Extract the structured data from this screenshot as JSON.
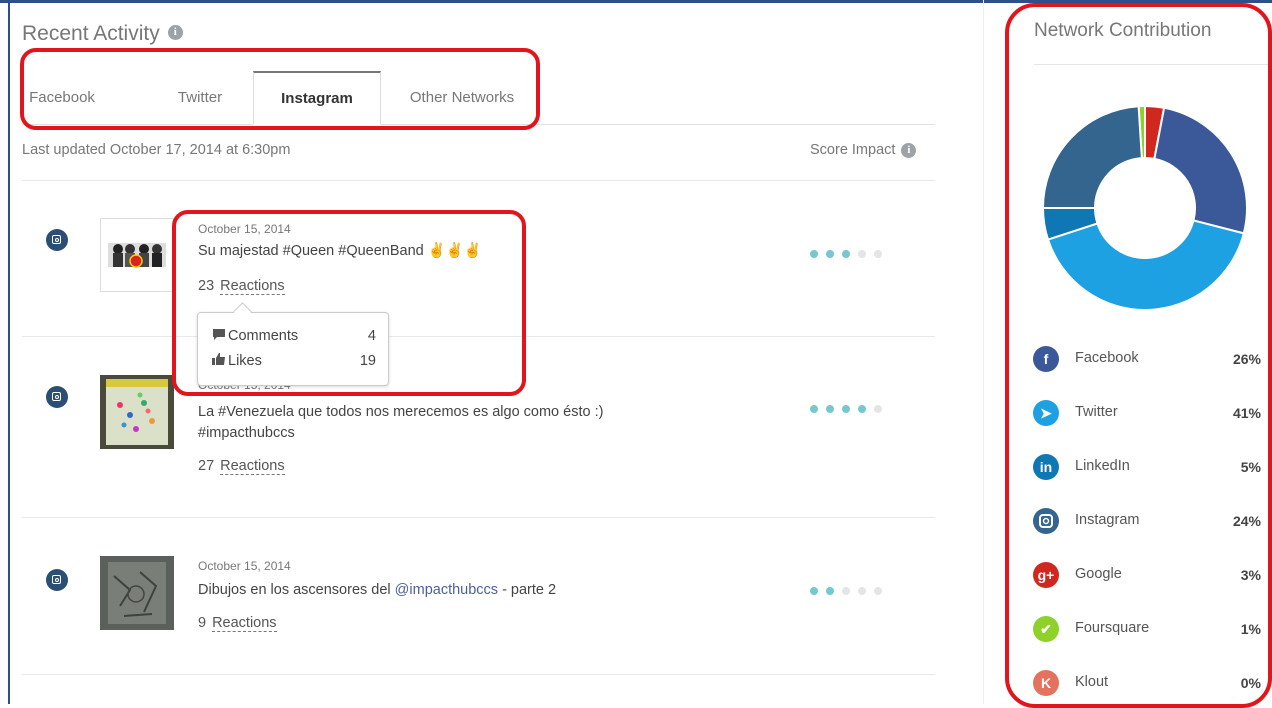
{
  "header": {
    "title": "Recent Activity"
  },
  "tabs": [
    {
      "label": "Facebook",
      "active": false
    },
    {
      "label": "Twitter",
      "active": false
    },
    {
      "label": "Instagram",
      "active": true
    },
    {
      "label": "Other Networks",
      "active": false
    }
  ],
  "last_updated": "Last updated October 17, 2014 at 6:30pm",
  "score_impact_label": "Score Impact",
  "posts": [
    {
      "network_icon": "instagram-icon",
      "date": "October 15, 2014",
      "text": "Su majestad #Queen #QueenBand ✌✌✌",
      "text_line2": "",
      "mention": "",
      "suffix": "",
      "reactions_count": "23",
      "reactions_label": "Reactions",
      "score": 3,
      "score_max": 5
    },
    {
      "network_icon": "instagram-icon",
      "date": "October 15, 2014",
      "text": "La #Venezuela que todos nos merecemos es algo como ésto :)",
      "text_line2": "#impacthubccs",
      "mention": "",
      "suffix": "",
      "reactions_count": "27",
      "reactions_label": "Reactions",
      "score": 4,
      "score_max": 5
    },
    {
      "network_icon": "instagram-icon",
      "date": "October 15, 2014",
      "text": "Dibujos en los ascensores del ",
      "text_line2": "",
      "mention": "@impacthubccs",
      "suffix": " - parte 2",
      "reactions_count": "9",
      "reactions_label": "Reactions",
      "score": 2,
      "score_max": 5
    }
  ],
  "popover": {
    "comments_label": "Comments",
    "comments_value": "4",
    "likes_label": "Likes",
    "likes_value": "19"
  },
  "network_contribution": {
    "title": "Network Contribution",
    "items": [
      {
        "name": "Facebook",
        "pct": "26%",
        "value": 26,
        "color": "#3b5998",
        "icon": "facebook-icon",
        "glyph": "f"
      },
      {
        "name": "Twitter",
        "pct": "41%",
        "value": 41,
        "color": "#1da1e2",
        "icon": "twitter-icon",
        "glyph": "➤"
      },
      {
        "name": "LinkedIn",
        "pct": "5%",
        "value": 5,
        "color": "#0f77b4",
        "icon": "linkedin-icon",
        "glyph": "in"
      },
      {
        "name": "Instagram",
        "pct": "24%",
        "value": 24,
        "color": "#33658f",
        "icon": "instagram-icon",
        "glyph": ""
      },
      {
        "name": "Google",
        "pct": "3%",
        "value": 3,
        "color": "#d0281f",
        "icon": "google-plus-icon",
        "glyph": "g+"
      },
      {
        "name": "Foursquare",
        "pct": "1%",
        "value": 1,
        "color": "#8dd12a",
        "icon": "foursquare-icon",
        "glyph": "✔"
      },
      {
        "name": "Klout",
        "pct": "0%",
        "value": 0,
        "color": "#e3735e",
        "icon": "klout-icon",
        "glyph": "K"
      }
    ]
  }
}
